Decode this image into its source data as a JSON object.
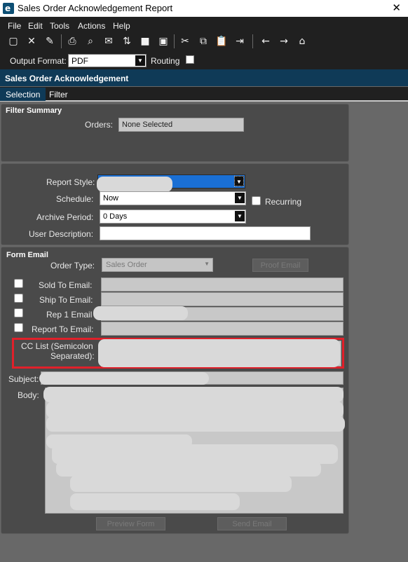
{
  "window": {
    "title": "Sales Order Acknowledgement Report",
    "close_glyph": "✕"
  },
  "menu": [
    "File",
    "Edit",
    "Tools",
    "Actions",
    "Help"
  ],
  "toolbar": {
    "icons": [
      "new-icon",
      "delete-icon",
      "clear-icon",
      "print-icon",
      "print-preview-icon",
      "email-icon",
      "attach-icon",
      "stop-icon",
      "save-layout-icon",
      "cut-icon",
      "copy-icon",
      "paste-icon",
      "exit-icon",
      "back-icon",
      "forward-icon",
      "home-icon"
    ],
    "output_format_label": "Output Format:",
    "output_format_value": "PDF",
    "routing_label": "Routing"
  },
  "header": {
    "title": "Sales Order Acknowledgement"
  },
  "tabs": {
    "selection": "Selection",
    "filter": "Filter"
  },
  "filter_summary": {
    "heading": "Filter Summary",
    "orders_label": "Orders:",
    "orders_value": "None Selected"
  },
  "report": {
    "report_style_label": "Report Style:",
    "schedule_label": "Schedule:",
    "schedule_value": "Now",
    "recurring_label": "Recurring",
    "archive_label": "Archive Period:",
    "archive_value": "0 Days",
    "user_desc_label": "User Description:"
  },
  "form_email": {
    "heading": "Form Email",
    "order_type_label": "Order Type:",
    "order_type_value": "Sales Order",
    "proof_email_label": "Proof Email",
    "sold_to_label": "Sold To Email:",
    "ship_to_label": "Ship To Email:",
    "rep1_label": "Rep 1 Email",
    "report_to_label": "Report To Email:",
    "cc_label_1": "CC List (Semicolon",
    "cc_label_2": "Separated):",
    "subject_label": "Subject:",
    "body_label": "Body:",
    "preview_label": "Preview Form",
    "send_label": "Send Email"
  },
  "colors": {
    "highlight_border": "#e0202a",
    "header_bg": "#0f3a57",
    "selected_field": "#1a6fd4"
  }
}
